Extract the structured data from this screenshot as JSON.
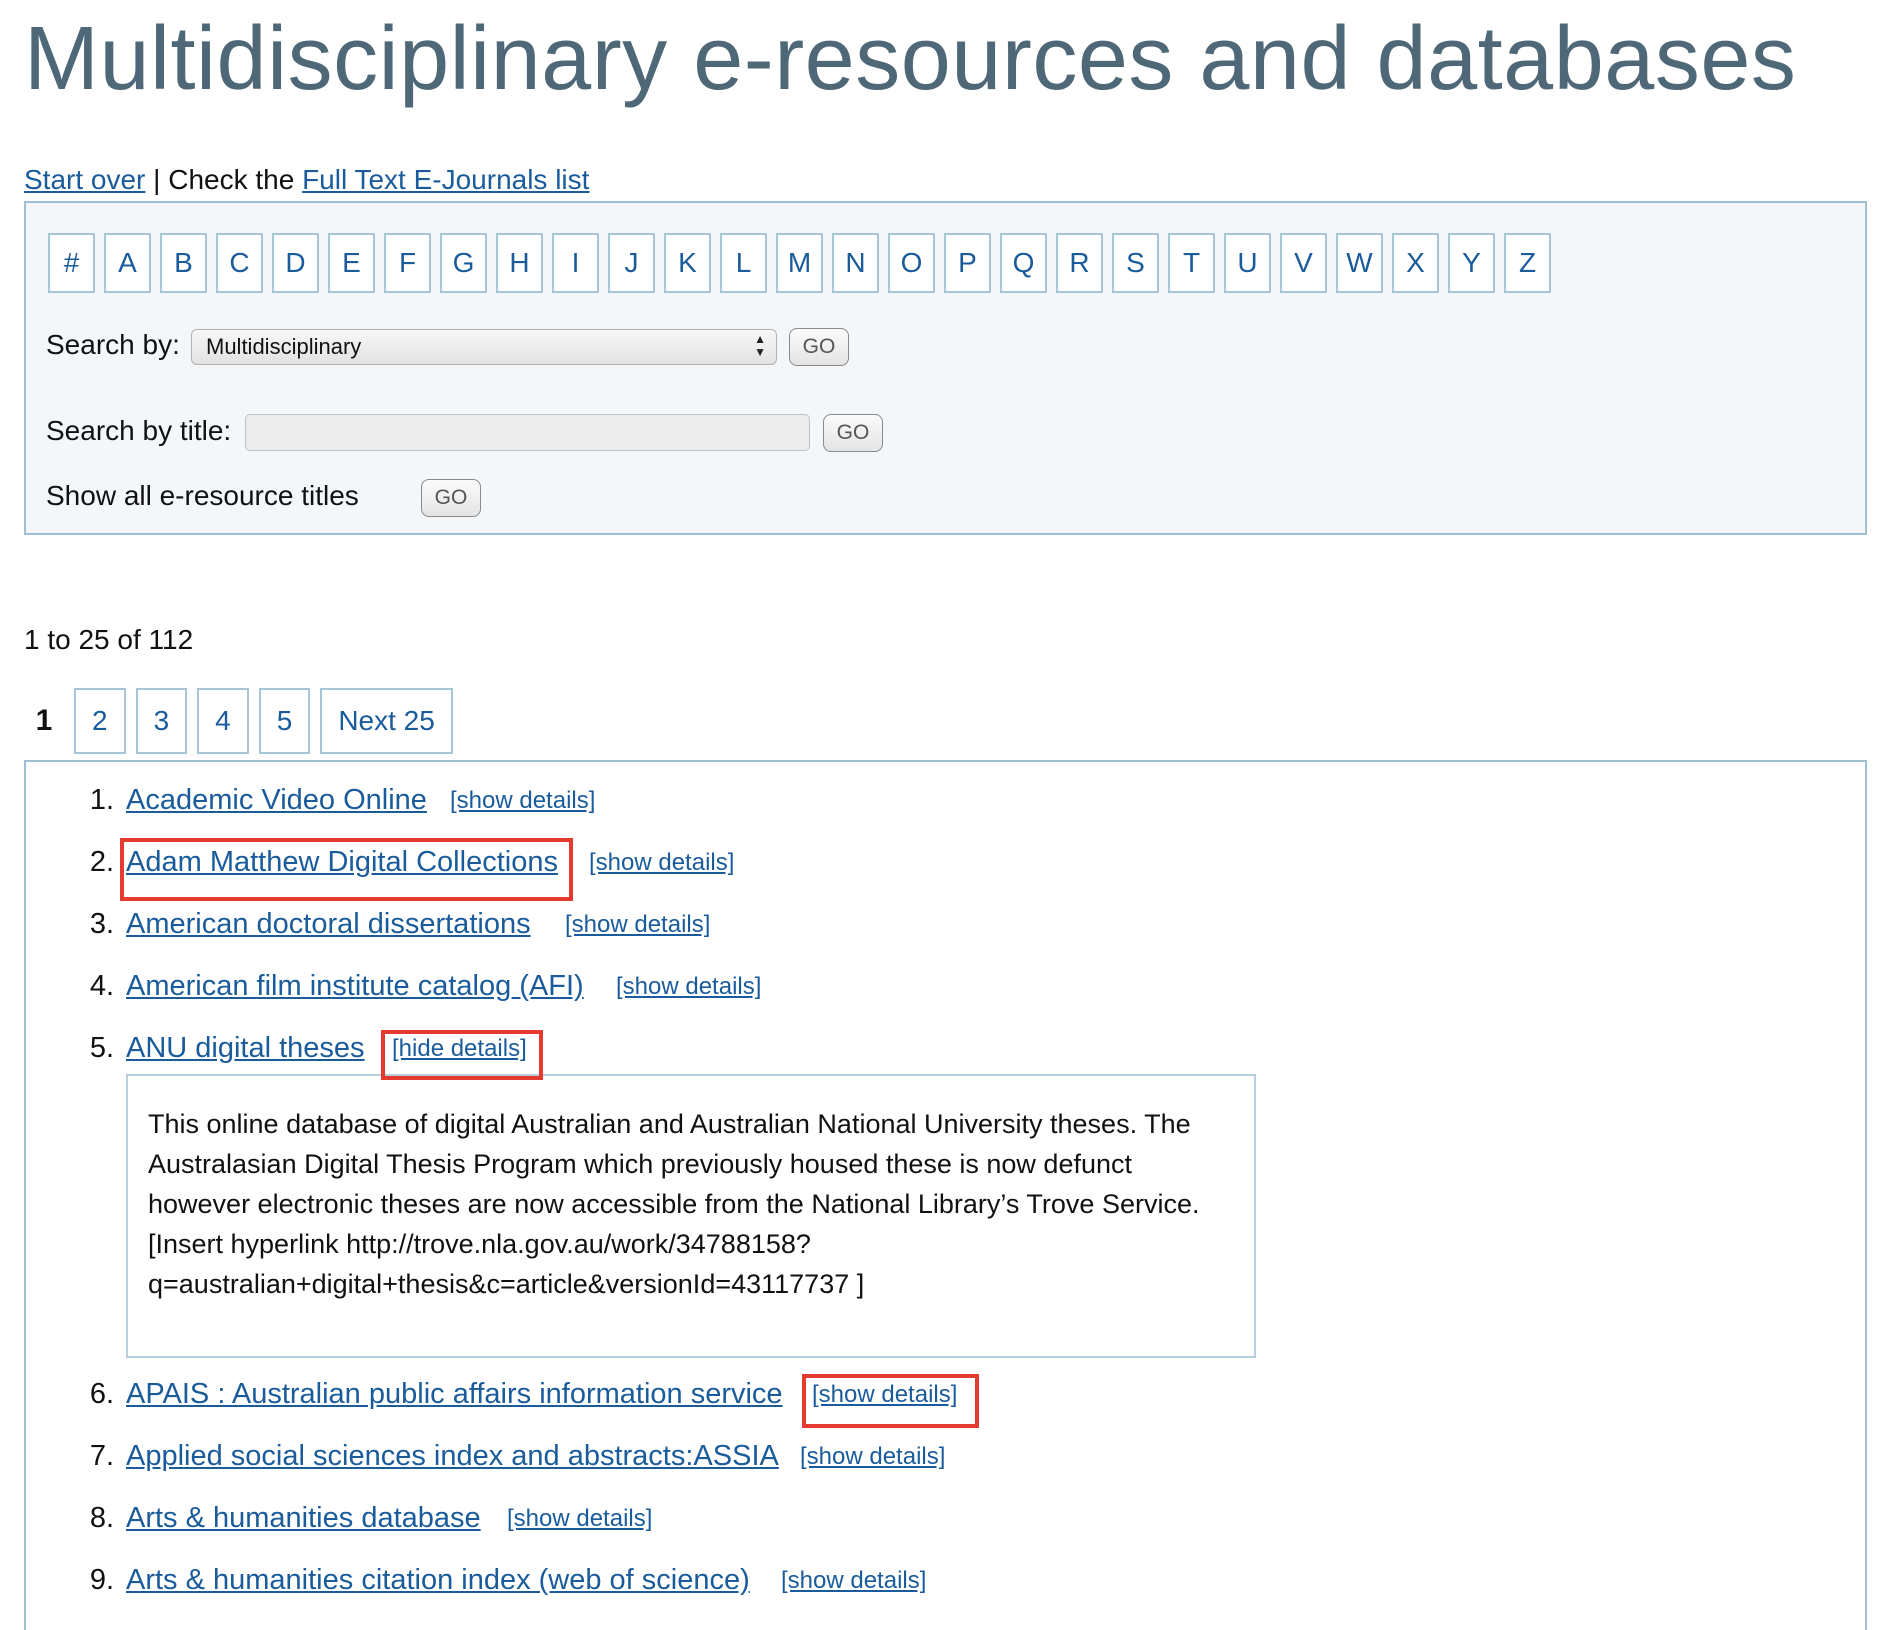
{
  "page": {
    "title": "Multidisciplinary e-resources and databases"
  },
  "topline": {
    "start_over": "Start over",
    "separator": "| Check the",
    "full_text_link": "Full Text E-Journals list"
  },
  "alphabet": [
    "#",
    "A",
    "B",
    "C",
    "D",
    "E",
    "F",
    "G",
    "H",
    "I",
    "J",
    "K",
    "L",
    "M",
    "N",
    "O",
    "P",
    "Q",
    "R",
    "S",
    "T",
    "U",
    "V",
    "W",
    "X",
    "Y",
    "Z"
  ],
  "search": {
    "search_by_label": "Search by:",
    "search_by_value": "Multidisciplinary",
    "search_by_title_label": "Search by title:",
    "search_by_title_value": "",
    "show_all_label": "Show all e-resource titles",
    "go_label": "GO"
  },
  "results": {
    "count_text": "1 to 25 of 112",
    "pager": {
      "current": "1",
      "pages": [
        "2",
        "3",
        "4",
        "5"
      ],
      "next_label": "Next 25"
    },
    "items": [
      {
        "num": "1.",
        "title": "Academic Video Online",
        "toggle": "[show details]"
      },
      {
        "num": "2.",
        "title": "Adam Matthew Digital Collections",
        "toggle": "[show details]"
      },
      {
        "num": "3.",
        "title": "American doctoral dissertations",
        "toggle": "[show details]"
      },
      {
        "num": "4.",
        "title": "American film institute catalog (AFI)",
        "toggle": "[show details]"
      },
      {
        "num": "5.",
        "title": "ANU digital theses",
        "toggle": "[hide details]",
        "details": "This online database of digital Australian and Australian National University theses. The Australasian Digital Thesis Program which previously housed these is now defunct however electronic theses are now accessible from the National Library’s Trove Service. [Insert hyperlink http://trove.nla.gov.au/work/34788158?q=australian+digital+thesis&c=article&versionId=43117737 ]"
      },
      {
        "num": "6.",
        "title": "APAIS : Australian public affairs information service",
        "toggle": "[show details]"
      },
      {
        "num": "7.",
        "title": "Applied social sciences index and abstracts:ASSIA",
        "toggle": "[show details]"
      },
      {
        "num": "8.",
        "title": "Arts & humanities database",
        "toggle": "[show details]"
      },
      {
        "num": "9.",
        "title": "Arts & humanities citation index (web of science)",
        "toggle": "[show details]"
      }
    ]
  },
  "colors": {
    "title": "#4f6878",
    "link": "#1a5b9b",
    "panel_border": "#9fc0d4",
    "panel_bg": "#f3f7fa",
    "highlight": "#e43a2f"
  }
}
